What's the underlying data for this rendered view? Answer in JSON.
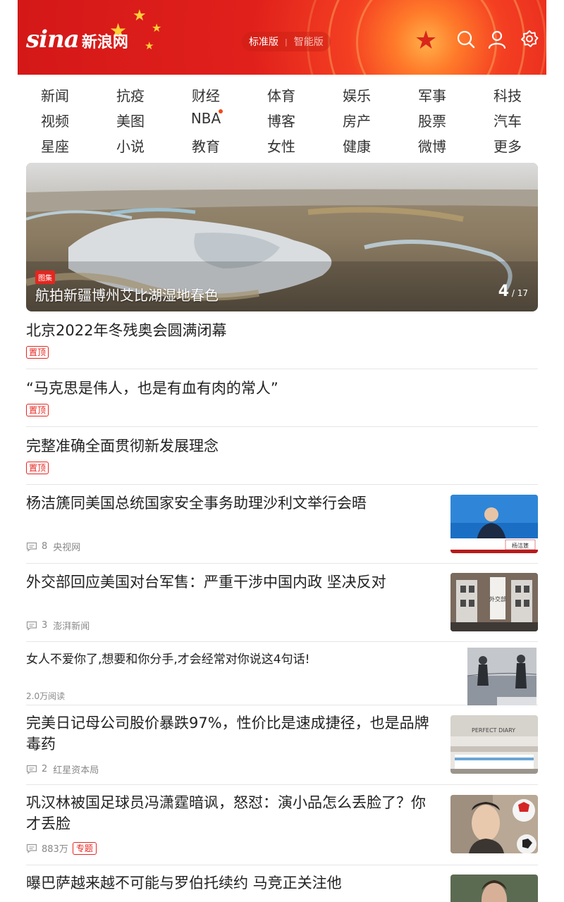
{
  "header": {
    "logo_latin": "sina",
    "logo_cn": "新浪网",
    "version_active": "标准版",
    "version_inactive": "智能版",
    "icons": [
      "search-icon",
      "user-icon",
      "settings-icon"
    ]
  },
  "nav": {
    "rows": [
      [
        "新闻",
        "抗疫",
        "财经",
        "体育",
        "娱乐",
        "军事",
        "科技"
      ],
      [
        "视频",
        "美图",
        "NBA",
        "博客",
        "房产",
        "股票",
        "汽车"
      ],
      [
        "星座",
        "小说",
        "教育",
        "女性",
        "健康",
        "微博",
        "更多"
      ]
    ],
    "badge_item": "NBA"
  },
  "banner": {
    "tag": "图集",
    "title": "航拍新疆博州艾比湖湿地春色",
    "current": "4",
    "total": "/ 17"
  },
  "pinned": [
    {
      "title": "北京2022年冬残奥会圆满闭幕",
      "tag": "置顶"
    },
    {
      "title": "“马克思是伟人，也是有血有肉的常人”",
      "tag": "置顶"
    },
    {
      "title": "完整准确全面贯彻新发展理念",
      "tag": "置顶"
    }
  ],
  "news": [
    {
      "title": "杨洁篪同美国总统国家安全事务助理沙利文举行会晤",
      "comments": "8",
      "source": "央视网"
    },
    {
      "title": "外交部回应美国对台军售：严重干涉中国内政 坚决反对",
      "comments": "3",
      "source": "澎湃新闻"
    }
  ],
  "ad": {
    "title": "女人不爱你了,想要和你分手,才会经常对你说这4句话!",
    "reads": "2.0万阅读"
  },
  "news2": [
    {
      "title_line1": "完美日记母公司股价暴跌97%，性价比是速成捷径，也是品牌",
      "title_line2": "毒药",
      "comments": "2",
      "source": "红星资本局"
    },
    {
      "title_line1": "巩汉林被国足球员冯潇霆暗讽，怒怼：演小品怎么丢脸了？你",
      "title_line2": "才丢脸",
      "comments": "883万",
      "tag": "专题"
    },
    {
      "title_line1": "曝巴萨越来越不可能与罗伯托续约 马竞正关注他"
    }
  ],
  "thumb_caption": "杨洁篪",
  "thumb2_caption": "外交部",
  "thumb3_caption": "PERFECT DIARY"
}
